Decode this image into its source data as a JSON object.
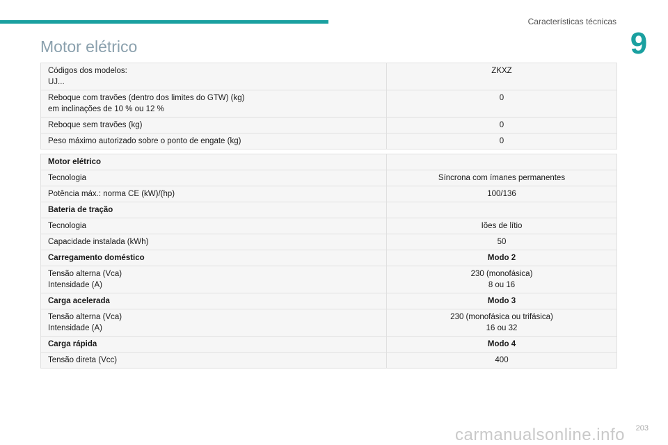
{
  "header": {
    "section": "Características técnicas",
    "chapter_number": "9",
    "accent_color": "#1aa0a0"
  },
  "page_title": "Motor elétrico",
  "towing_table": {
    "rows": [
      {
        "label_line1": "Códigos dos modelos:",
        "label_line2": "UJ...",
        "value_line1": "ZKXZ",
        "value_line2": ""
      },
      {
        "label_line1": "Reboque com travões (dentro dos limites do GTW) (kg)",
        "label_line2": "em inclinações de 10 % ou 12 %",
        "value_line1": "0",
        "value_line2": ""
      },
      {
        "label_line1": "Reboque sem travões (kg)",
        "label_line2": "",
        "value_line1": "0",
        "value_line2": ""
      },
      {
        "label_line1": "Peso máximo autorizado sobre o ponto de engate (kg)",
        "label_line2": "",
        "value_line1": "0",
        "value_line2": ""
      }
    ]
  },
  "motor_table": {
    "rows": [
      {
        "label_line1": "Motor elétrico",
        "label_line2": "",
        "value_line1": "",
        "value_line2": "",
        "bold": true
      },
      {
        "label_line1": "Tecnologia",
        "label_line2": "",
        "value_line1": "Síncrona com ímanes permanentes",
        "value_line2": "",
        "bold": false
      },
      {
        "label_line1": "Potência máx.: norma CE (kW)/(hp)",
        "label_line2": "",
        "value_line1": "100/136",
        "value_line2": "",
        "bold": false
      },
      {
        "label_line1": "Bateria de tração",
        "label_line2": "",
        "value_line1": "",
        "value_line2": "",
        "bold": true
      },
      {
        "label_line1": "Tecnologia",
        "label_line2": "",
        "value_line1": "Iões de lítio",
        "value_line2": "",
        "bold": false
      },
      {
        "label_line1": "Capacidade instalada (kWh)",
        "label_line2": "",
        "value_line1": "50",
        "value_line2": "",
        "bold": false
      },
      {
        "label_line1": "Carregamento doméstico",
        "label_line2": "",
        "value_line1": "Modo 2",
        "value_line2": "",
        "bold": true
      },
      {
        "label_line1": "Tensão alterna (Vca)",
        "label_line2": "Intensidade (A)",
        "value_line1": "230 (monofásica)",
        "value_line2": "8 ou 16",
        "bold": false
      },
      {
        "label_line1": "Carga acelerada",
        "label_line2": "",
        "value_line1": "Modo 3",
        "value_line2": "",
        "bold": true
      },
      {
        "label_line1": "Tensão alterna (Vca)",
        "label_line2": "Intensidade (A)",
        "value_line1": "230 (monofásica ou trifásica)",
        "value_line2": "16 ou 32",
        "bold": false
      },
      {
        "label_line1": "Carga rápida",
        "label_line2": "",
        "value_line1": "Modo 4",
        "value_line2": "",
        "bold": true
      },
      {
        "label_line1": "Tensão direta (Vcc)",
        "label_line2": "",
        "value_line1": "400",
        "value_line2": "",
        "bold": false
      }
    ]
  },
  "footer": {
    "page_number": "203",
    "watermark": "carmanualsonline.info"
  }
}
